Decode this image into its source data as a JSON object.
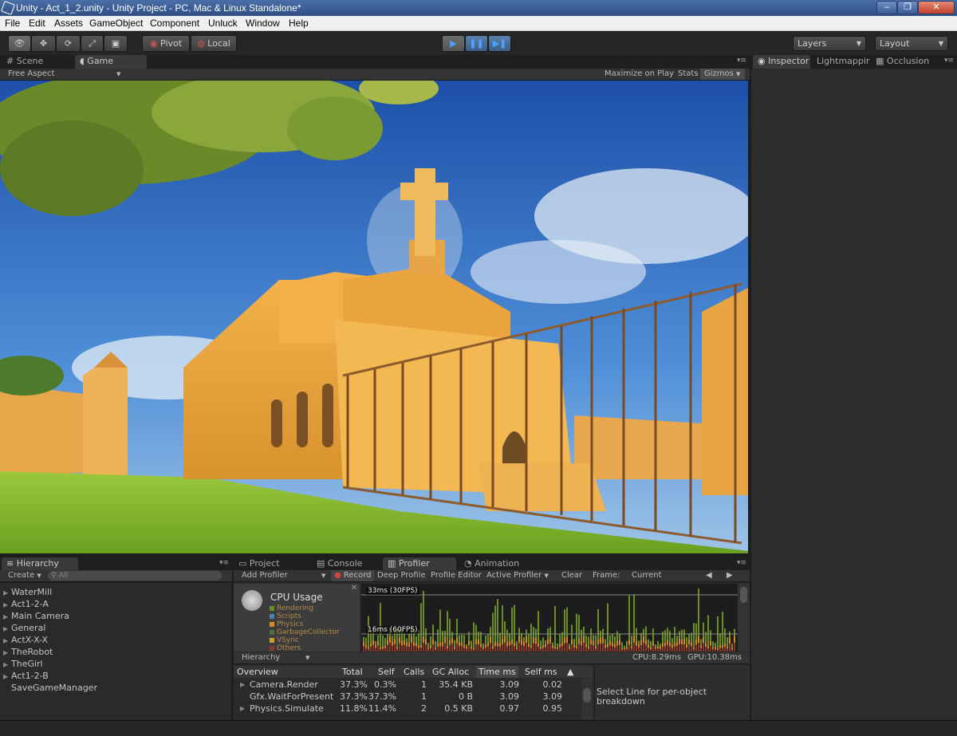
{
  "window": {
    "title": "Unity - Act_1_2.unity - Unity Project - PC, Mac & Linux Standalone*",
    "controls": [
      "–",
      "❐",
      "✕"
    ]
  },
  "menu": [
    "File",
    "Edit",
    "Assets",
    "GameObject",
    "Component",
    "Unluck",
    "Window",
    "Help"
  ],
  "toolbar": {
    "pivot": "Pivot",
    "local": "Local",
    "layers": "Layers",
    "layout": "Layout"
  },
  "scene_tabs": {
    "scene": "Scene",
    "game": "Game",
    "aspect": "Free Aspect",
    "maximize": "Maximize on Play",
    "stats": "Stats",
    "gizmos": "Gizmos"
  },
  "inspector_tabs": {
    "inspector": "Inspector",
    "lightmapping": "Lightmappir",
    "occlusion": "Occlusion"
  },
  "hierarchy": {
    "tab": "Hierarchy",
    "create": "Create",
    "search_placeholder": "All",
    "items": [
      {
        "label": "WaterMill",
        "expandable": true
      },
      {
        "label": "Act1-2-A",
        "expandable": true
      },
      {
        "label": "Main Camera",
        "expandable": true
      },
      {
        "label": "General",
        "expandable": true
      },
      {
        "label": "ActX-X-X",
        "expandable": true
      },
      {
        "label": "TheRobot",
        "expandable": true
      },
      {
        "label": "TheGirl",
        "expandable": true
      },
      {
        "label": "Act1-2-B",
        "expandable": true
      },
      {
        "label": "SaveGameManager",
        "expandable": false
      }
    ]
  },
  "bottom_tabs": {
    "project": "Project",
    "console": "Console",
    "profiler": "Profiler",
    "animation": "Animation"
  },
  "profiler": {
    "add_profiler": "Add Profiler",
    "record": "Record",
    "deep_profile": "Deep Profile",
    "profile_editor": "Profile Editor",
    "active_profiler": "Active Profiler",
    "clear": "Clear",
    "frame_label": "Frame:",
    "frame_value": "Current",
    "cpu_title": "CPU Usage",
    "legend": [
      {
        "name": "Rendering",
        "color": "#6b8e23"
      },
      {
        "name": "Scripts",
        "color": "#4a7fb0"
      },
      {
        "name": "Physics",
        "color": "#d88b24"
      },
      {
        "name": "GarbageCollector",
        "color": "#4b6e3a"
      },
      {
        "name": "VSync",
        "color": "#c9a227"
      },
      {
        "name": "Others",
        "color": "#8a3a2a"
      }
    ],
    "line_30fps": "33ms (30FPS)",
    "line_60fps": "16ms (60FPS)",
    "view_mode": "Hierarchy",
    "cpu_time": "CPU:8.29ms",
    "gpu_time": "GPU:10.38ms",
    "columns": [
      "Overview",
      "Total",
      "Self",
      "Calls",
      "GC Alloc",
      "Time ms",
      "Self ms"
    ],
    "rows": [
      {
        "name": "Camera.Render",
        "total": "37.3%",
        "self": "0.3%",
        "calls": "1",
        "gc": "35.4 KB",
        "time": "3.09",
        "selfms": "0.02",
        "expandable": true
      },
      {
        "name": "Gfx.WaitForPresent",
        "total": "37.3%",
        "self": "37.3%",
        "calls": "1",
        "gc": "0 B",
        "time": "3.09",
        "selfms": "3.09",
        "expandable": false
      },
      {
        "name": "Physics.Simulate",
        "total": "11.8%",
        "self": "11.4%",
        "calls": "2",
        "gc": "0.5 KB",
        "time": "0.97",
        "selfms": "0.95",
        "expandable": true
      }
    ],
    "detail_hint": "Select Line for per-object breakdown"
  }
}
